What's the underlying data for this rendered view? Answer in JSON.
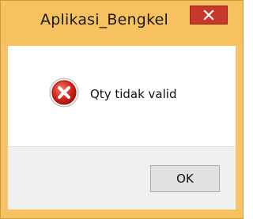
{
  "window": {
    "title": "Aplikasi_Bengkel",
    "frame_color": "#f7c160",
    "close_color": "#c7372b"
  },
  "dialog": {
    "icon": "error-icon",
    "message": "Qty tidak valid"
  },
  "buttons": {
    "ok_label": "OK"
  }
}
